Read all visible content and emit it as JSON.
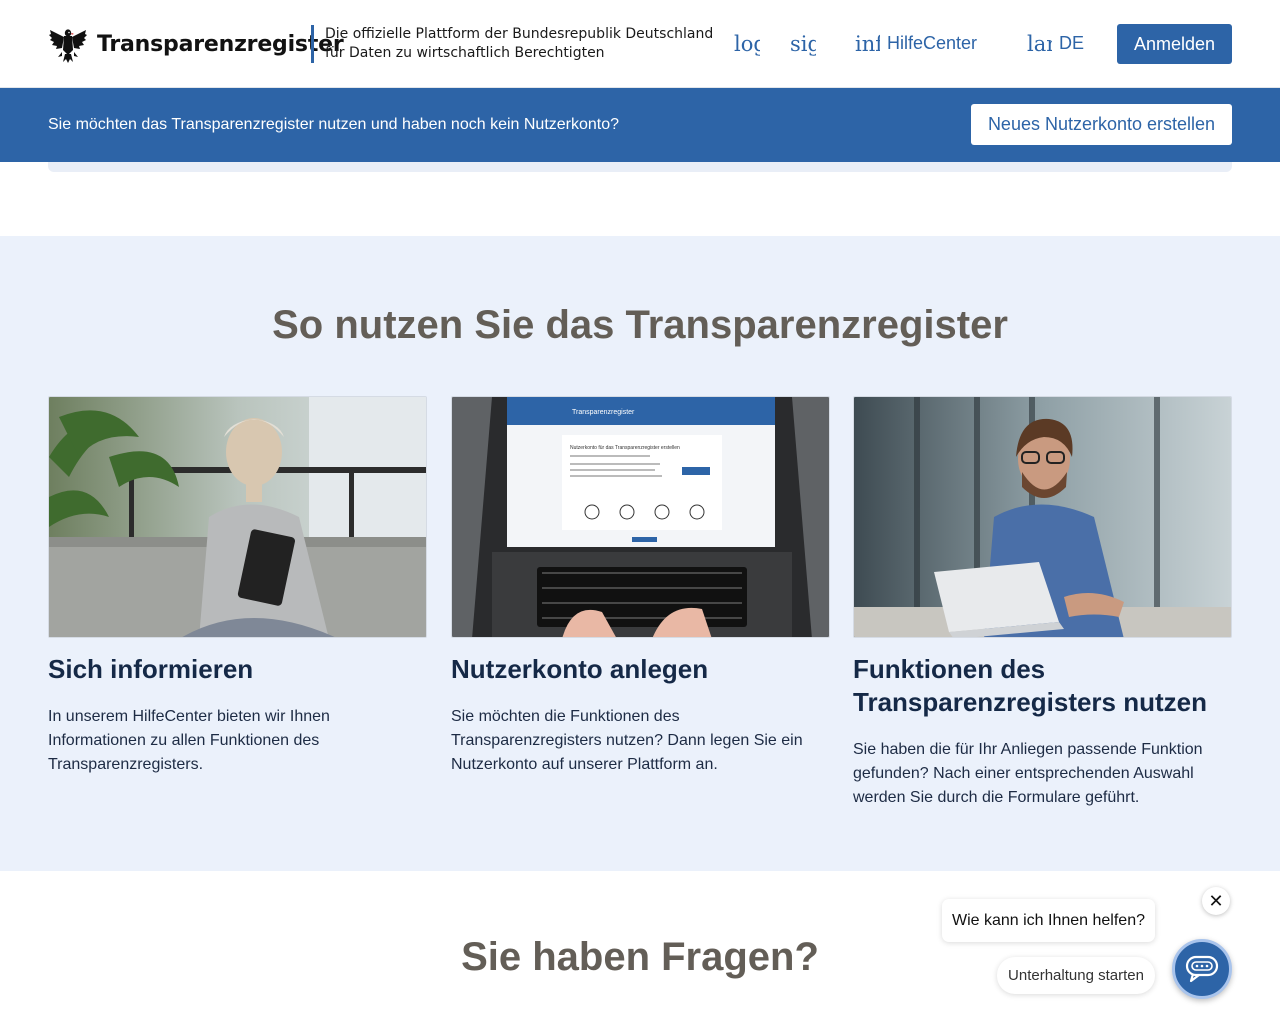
{
  "header": {
    "brand": "Transparenzregister",
    "tagline_line1": "Die offizielle Plattform der Bundesrepublik Deutschland",
    "tagline_line2": "für Daten zu wirtschaftlich Berechtigten",
    "nav": {
      "login_broken": "login",
      "signup_broken": "signup",
      "info_broken": "info",
      "help": "HilfeCenter",
      "language_broken": "language",
      "language": "DE"
    },
    "login_button": "Anmelden"
  },
  "banner": {
    "text": "Sie möchten das Transparenzregister nutzen und haben noch kein Nutzerkonto?",
    "button": "Neues Nutzerkonto erstellen"
  },
  "usage": {
    "title": "So nutzen Sie das Transparenzregister",
    "cards": [
      {
        "title": "Sich informieren",
        "text": "In unserem HilfeCenter bieten wir Ihnen Informationen zu allen Funktionen des Transparenzregisters."
      },
      {
        "title": "Nutzerkonto anlegen",
        "text": "Sie möchten die Funktionen des Transparenzregisters nutzen? Dann legen Sie ein Nutzerkonto auf unserer Plattform an."
      },
      {
        "title": "Funktionen des Transparenzregisters nutzen",
        "text": "Sie haben die für Ihr Anliegen passende Funktion gefunden? Nach einer entsprechenden Auswahl werden Sie durch die Formulare geführt."
      }
    ]
  },
  "questions": {
    "title": "Sie haben Fragen?"
  },
  "chat": {
    "close": "✕",
    "bubble": "Wie kann ich Ihnen helfen?",
    "start": "Unterhaltung starten"
  },
  "colors": {
    "primary": "#2d64a7",
    "section_bg": "#ebf1fb",
    "heading_gray": "#635e57",
    "heading_navy": "#152947"
  },
  "laptop_screen": {
    "brand": "Transparenzregister",
    "heading": "Nutzerkonto für das Transparenzregister erstellen",
    "button": "Jetzt starten"
  }
}
